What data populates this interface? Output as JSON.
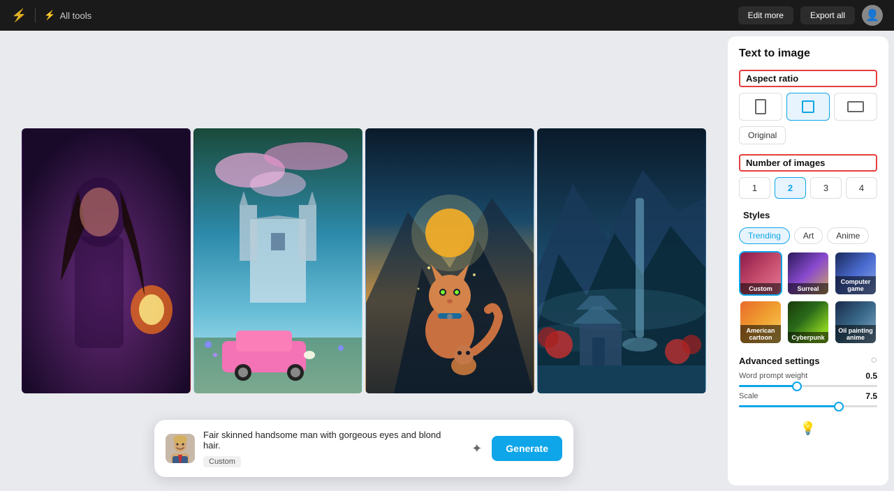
{
  "topbar": {
    "logo_icon": "⚡",
    "all_tools_label": "All tools",
    "edit_more_label": "Edit more",
    "export_all_label": "Export all"
  },
  "prompt": {
    "text": "Fair skinned handsome man with gorgeous eyes and blond hair.",
    "tag": "Custom",
    "generate_label": "Generate"
  },
  "panel": {
    "title": "Text to image",
    "aspect_ratio_label": "Aspect ratio",
    "aspect_options": [
      {
        "id": "portrait",
        "label": "Portrait"
      },
      {
        "id": "square",
        "label": "Square"
      },
      {
        "id": "landscape",
        "label": "Landscape"
      }
    ],
    "original_label": "Original",
    "number_of_images_label": "Number of images",
    "num_options": [
      "1",
      "2",
      "3",
      "4"
    ],
    "num_active": "2",
    "styles_label": "Styles",
    "style_tabs": [
      "Trending",
      "Art",
      "Anime"
    ],
    "style_tab_active": "Trending",
    "style_cards": [
      {
        "id": "custom",
        "name": "Custom",
        "active": true
      },
      {
        "id": "surreal",
        "name": "Surreal",
        "active": false
      },
      {
        "id": "computer-game",
        "name": "Computer game",
        "active": false
      },
      {
        "id": "american-cartoon",
        "name": "American cartoon",
        "active": false
      },
      {
        "id": "cyberpunk",
        "name": "Cyberpunk",
        "active": false
      },
      {
        "id": "oil-painting-anime",
        "name": "Oil painting anime",
        "active": false
      }
    ],
    "advanced_settings_label": "Advanced settings",
    "word_prompt_weight_label": "Word prompt weight",
    "word_prompt_weight_value": "0.5",
    "word_prompt_weight_pct": 42,
    "scale_label": "Scale",
    "scale_value": "7.5",
    "scale_pct": 72
  }
}
